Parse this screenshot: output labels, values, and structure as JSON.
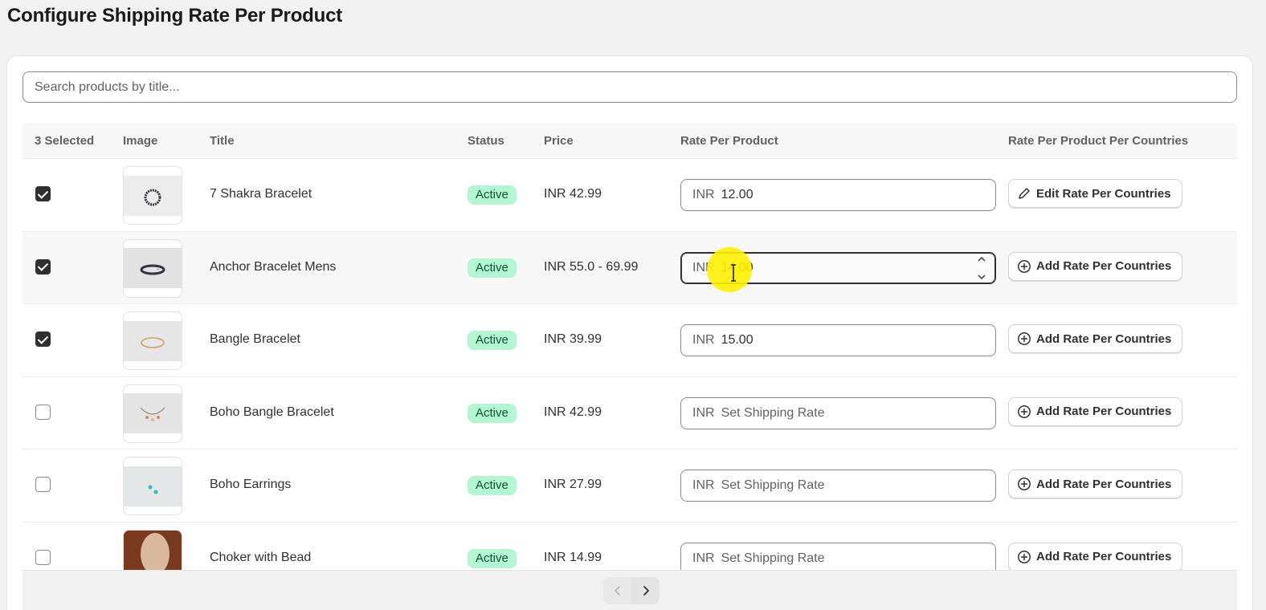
{
  "page": {
    "title": "Configure Shipping Rate Per Product"
  },
  "search": {
    "placeholder": "Search products by title..."
  },
  "table": {
    "headers": {
      "selected": "3 Selected",
      "image": "Image",
      "title": "Title",
      "status": "Status",
      "price": "Price",
      "rate": "Rate Per Product",
      "countries": "Rate Per Product Per Countries"
    },
    "rows": [
      {
        "title": "7 Shakra Bracelet",
        "status": "Active",
        "price": "INR 42.99",
        "currency": "INR",
        "rate": "12.00",
        "rate_placeholder": "Set Shipping Rate",
        "action": "Edit Rate Per Countries",
        "action_icon": "pencil-icon",
        "checked": true
      },
      {
        "title": "Anchor Bracelet Mens",
        "status": "Active",
        "price": "INR 55.0 - 69.99",
        "currency": "INR",
        "rate": "14.00",
        "rate_placeholder": "Set Shipping Rate",
        "action": "Add Rate Per Countries",
        "action_icon": "plus-circle-icon",
        "checked": true
      },
      {
        "title": "Bangle Bracelet",
        "status": "Active",
        "price": "INR 39.99",
        "currency": "INR",
        "rate": "15.00",
        "rate_placeholder": "Set Shipping Rate",
        "action": "Add Rate Per Countries",
        "action_icon": "plus-circle-icon",
        "checked": true
      },
      {
        "title": "Boho Bangle Bracelet",
        "status": "Active",
        "price": "INR 42.99",
        "currency": "INR",
        "rate": "",
        "rate_placeholder": "Set Shipping Rate",
        "action": "Add Rate Per Countries",
        "action_icon": "plus-circle-icon",
        "checked": false
      },
      {
        "title": "Boho Earrings",
        "status": "Active",
        "price": "INR 27.99",
        "currency": "INR",
        "rate": "",
        "rate_placeholder": "Set Shipping Rate",
        "action": "Add Rate Per Countries",
        "action_icon": "plus-circle-icon",
        "checked": false
      },
      {
        "title": "Choker with Bead",
        "status": "Active",
        "price": "INR 14.99",
        "currency": "INR",
        "rate": "",
        "rate_placeholder": "Set Shipping Rate",
        "action": "Add Rate Per Countries",
        "action_icon": "plus-circle-icon",
        "checked": false
      }
    ]
  },
  "colors": {
    "badge_bg": "#b4f5d4",
    "badge_text": "#0c5132",
    "cursor_highlight": "#fff000"
  }
}
